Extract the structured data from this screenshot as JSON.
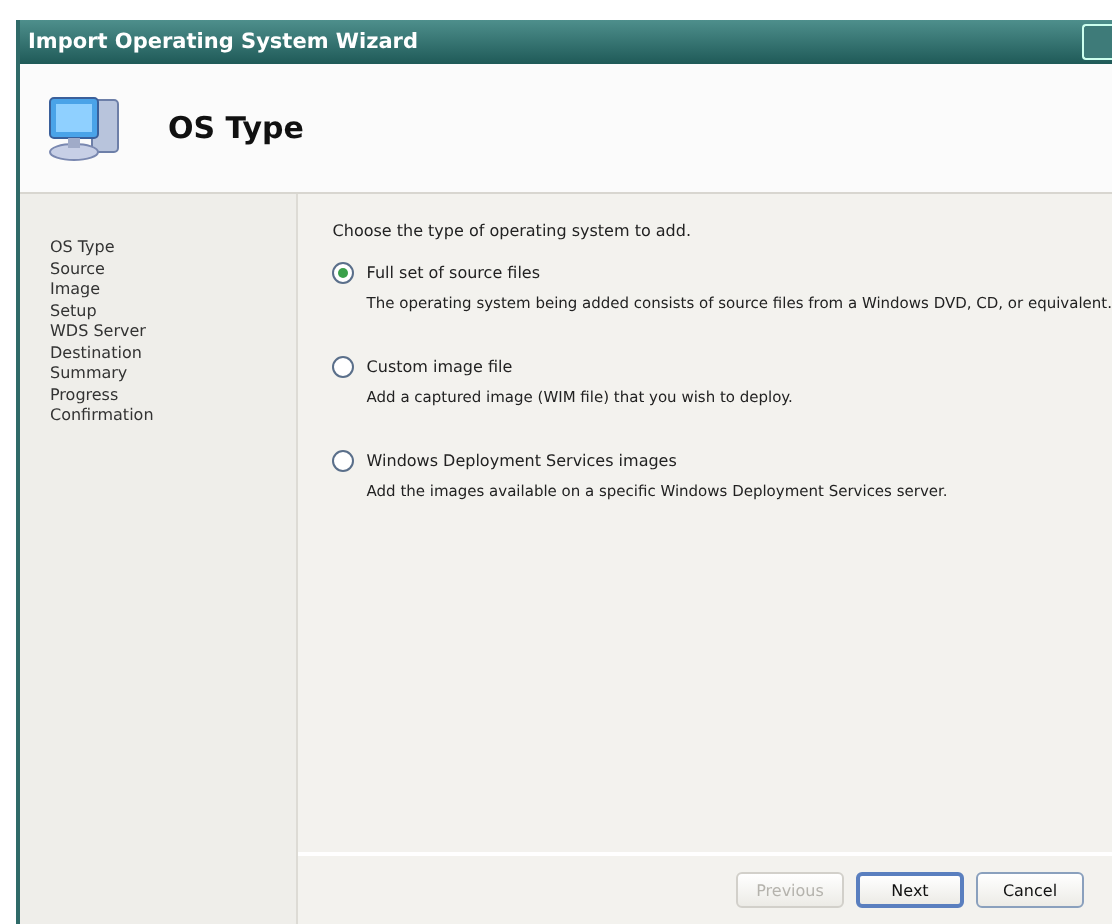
{
  "window": {
    "title": "Import Operating System Wizard"
  },
  "header": {
    "title": "OS Type"
  },
  "steps": [
    "OS Type",
    "Source",
    "Image",
    "Setup",
    "WDS Server",
    "Destination",
    "Summary",
    "Progress",
    "Confirmation"
  ],
  "prompt": "Choose the type of operating system to add.",
  "options": [
    {
      "label": "Full set of source files",
      "description": "The operating system being added consists of source files from a Windows DVD, CD, or equivalent.",
      "selected": true
    },
    {
      "label": "Custom image file",
      "description": "Add a captured image (WIM file) that you wish to deploy.",
      "selected": false
    },
    {
      "label": "Windows Deployment Services images",
      "description": "Add the images available on a specific Windows Deployment Services server.",
      "selected": false
    }
  ],
  "buttons": [
    {
      "label": "Previous",
      "disabled": true,
      "default": false
    },
    {
      "label": "Next",
      "disabled": false,
      "default": true
    },
    {
      "label": "Cancel",
      "disabled": false,
      "default": false
    }
  ]
}
